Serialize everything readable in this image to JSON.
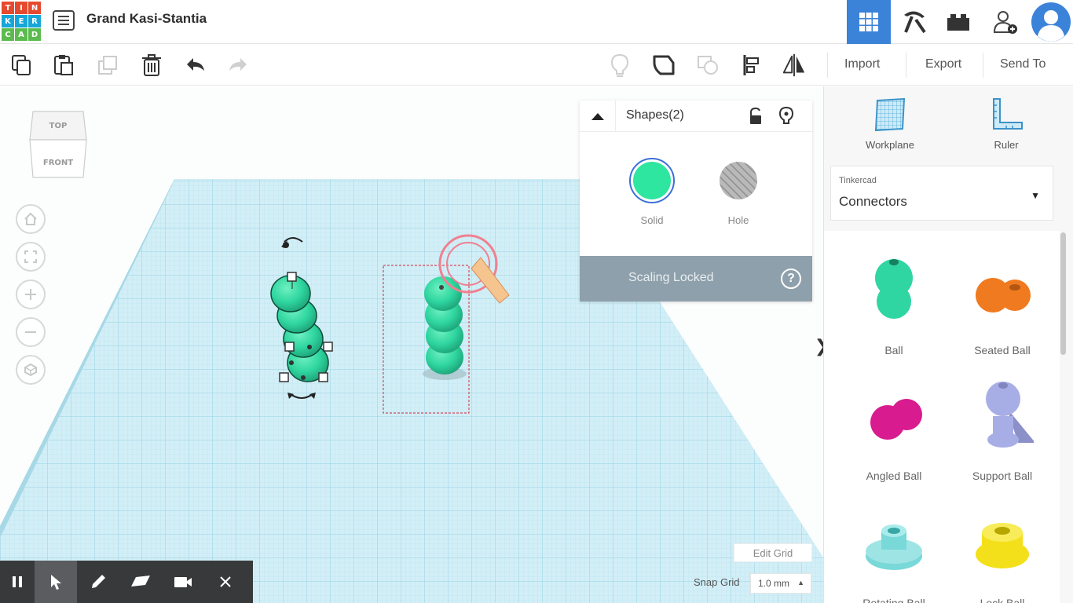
{
  "header": {
    "logo_letters": [
      "T",
      "I",
      "N",
      "K",
      "E",
      "R",
      "C",
      "A",
      "D"
    ],
    "logo_colors": [
      "#e64a2e",
      "#e64a2e",
      "#e64a2e",
      "#16a6d9",
      "#16a6d9",
      "#16a6d9",
      "#5bbb4e",
      "#5bbb4e",
      "#5bbb4e"
    ],
    "title": "Grand Kasi-Stantia",
    "nav": [
      "3d-design-view-icon",
      "codeblocks-pickaxe-icon",
      "bricks-icon",
      "add-user-icon"
    ],
    "accent": "#3b83d9"
  },
  "toolbar": {
    "actions": [
      "copy",
      "paste",
      "duplicate",
      "delete",
      "undo",
      "redo"
    ],
    "view_tools": [
      "notes-bulb",
      "show-all",
      "hide-toggle",
      "align",
      "mirror"
    ],
    "import_label": "Import",
    "export_label": "Export",
    "send_to_label": "Send To"
  },
  "viewcube": {
    "top_label": "TOP",
    "front_label": "FRONT"
  },
  "shapes_panel": {
    "title": "Shapes(2)",
    "solid_label": "Solid",
    "hole_label": "Hole",
    "solid_color": "#2ee6a0",
    "scaling_locked_label": "Scaling Locked",
    "help_glyph": "?"
  },
  "right_panel": {
    "workplane_label": "Workplane",
    "ruler_label": "Ruler",
    "library_category": "Tinkercad",
    "library_name": "Connectors",
    "shapes": [
      {
        "label": "Ball",
        "color": "#2fd6a1"
      },
      {
        "label": "Seated Ball",
        "color": "#f07a1f"
      },
      {
        "label": "Angled Ball",
        "color": "#d81b8e"
      },
      {
        "label": "Support Ball",
        "color": "#a7aee6"
      },
      {
        "label": "Rotating Ball",
        "color": "#79d8d8"
      },
      {
        "label": "Lock Ball",
        "color": "#f4e01a"
      }
    ]
  },
  "grid_controls": {
    "edit_grid_label": "Edit Grid",
    "snap_grid_label": "Snap Grid",
    "snap_value": "1.0 mm"
  },
  "bottom_toolbar": {
    "tools": [
      "pause",
      "select",
      "pencil",
      "eraser",
      "camera",
      "close"
    ]
  }
}
